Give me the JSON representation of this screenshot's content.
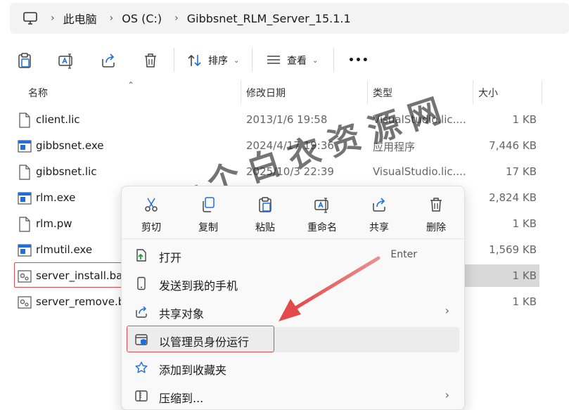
{
  "address": {
    "crumbs": [
      "此电脑",
      "OS (C:)",
      "Gibbsnet_RLM_Server_15.1.1"
    ]
  },
  "toolbar": {
    "sort_label": "排序",
    "view_label": "查看",
    "more_label": "•••"
  },
  "columns": {
    "name": "名称",
    "modified": "修改日期",
    "type": "类型",
    "size": "大小"
  },
  "files": [
    {
      "name": "client.lic",
      "modified": "2013/1/6 19:58",
      "type": "VisualStudio.lic....",
      "size": "1 KB",
      "icon": "file-icon"
    },
    {
      "name": "gibbsnet.exe",
      "modified": "2024/4/17 19:36",
      "type": "应用程序",
      "size": "7,446 KB",
      "icon": "exe-icon"
    },
    {
      "name": "gibbsnet.lic",
      "modified": "2025/10/3 22:39",
      "type": "VisualStudio.lic....",
      "size": "17 KB",
      "icon": "file-icon"
    },
    {
      "name": "rlm.exe",
      "modified": "",
      "type": "",
      "size": "2,824 KB",
      "icon": "exe-icon"
    },
    {
      "name": "rlm.pw",
      "modified": "",
      "type": "",
      "size": "1 KB",
      "icon": "file-icon"
    },
    {
      "name": "rlmutil.exe",
      "modified": "",
      "type": "",
      "size": "1,569 KB",
      "icon": "exe-icon"
    },
    {
      "name": "server_install.bat",
      "modified": "",
      "type": "",
      "size": "1 KB",
      "icon": "bat-icon"
    },
    {
      "name": "server_remove.b",
      "modified": "",
      "type": "",
      "size": "1 KB",
      "icon": "bat-icon"
    }
  ],
  "context_menu": {
    "actions": [
      "剪切",
      "复制",
      "粘贴",
      "重命名",
      "共享",
      "删除"
    ],
    "items": [
      {
        "label": "打开",
        "shortcut": "Enter",
        "icon": "open-icon"
      },
      {
        "label": "发送到我的手机",
        "icon": "phone-icon"
      },
      {
        "label": "共享对象",
        "icon": "share-icon",
        "chevron": "›"
      },
      {
        "label": "以管理员身份运行",
        "icon": "shield-icon"
      },
      {
        "label": "添加到收藏夹",
        "icon": "star-icon"
      },
      {
        "label": "压缩到...",
        "icon": "zip-icon",
        "chevron": "›"
      }
    ]
  },
  "watermark": "一个白衣资源网",
  "colors": {
    "annotation_red": "#e34a4a",
    "selection_gray": "#d9d9d9",
    "accent_blue": "#1e6fd9"
  }
}
